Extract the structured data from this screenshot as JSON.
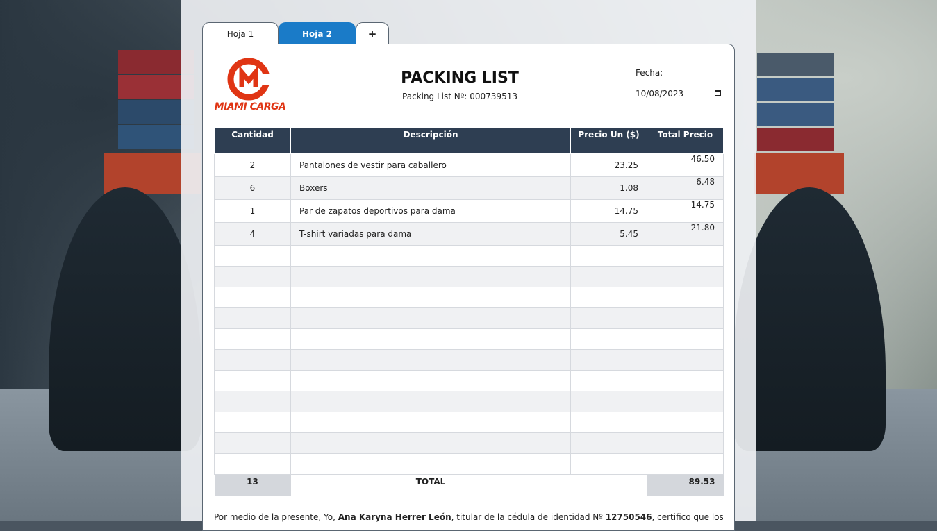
{
  "tabs": [
    {
      "label": "Hoja 1",
      "active": false
    },
    {
      "label": "Hoja 2",
      "active": true
    },
    {
      "label": "+",
      "active": false
    }
  ],
  "brand": {
    "logo_text": "MIAMI CARGA",
    "color": "#e03514"
  },
  "header": {
    "title": "PACKING LIST",
    "number_label": "Packing List Nº: 000739513",
    "date_label": "Fecha:",
    "date_value": "10/08/2023"
  },
  "table": {
    "headers": [
      "Cantidad",
      "Descripción",
      "Precio Un ($)",
      "Total Precio"
    ],
    "rows": [
      {
        "qty": "2",
        "desc": "Pantalones de vestir para caballero",
        "price": "23.25",
        "total": "46.50"
      },
      {
        "qty": "6",
        "desc": "Boxers",
        "price": "1.08",
        "total": "6.48"
      },
      {
        "qty": "1",
        "desc": "Par de zapatos deportivos para dama",
        "price": "14.75",
        "total": "14.75"
      },
      {
        "qty": "4",
        "desc": "T-shirt variadas para dama",
        "price": "5.45",
        "total": "21.80"
      }
    ],
    "empty_rows": 11,
    "total_qty": "13",
    "total_label": "TOTAL",
    "total_sum": "89.53"
  },
  "certify": {
    "prefix": "Por medio de la presente, Yo, ",
    "name": "Ana Karyna Herrer León",
    "middle": ", titular de la cédula de identidad Nº ",
    "id": "12750546",
    "suffix": ", certifico que los"
  },
  "colors": {
    "header_bg": "#2e3e52",
    "active_tab": "#1a7bc8",
    "accent": "#e03514"
  }
}
